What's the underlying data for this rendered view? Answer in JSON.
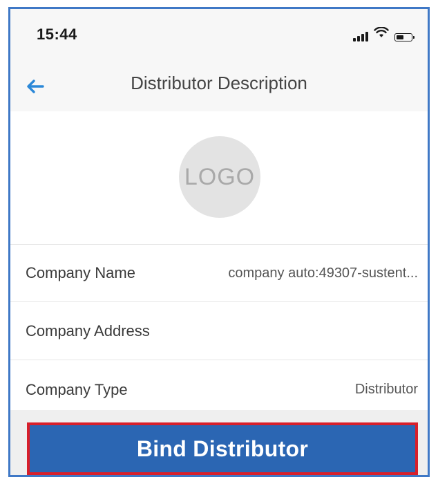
{
  "status_bar": {
    "time": "15:44",
    "icons": [
      "signal-icon",
      "wifi-icon",
      "battery-icon"
    ],
    "battery_level": 0.5
  },
  "nav_bar": {
    "back_icon": "arrow-left-icon",
    "title": "Distributor Description"
  },
  "logo": {
    "text": "LOGO"
  },
  "details": {
    "company_name": {
      "label": "Company Name",
      "value": "company auto:49307-sustent..."
    },
    "company_address": {
      "label": "Company Address",
      "value": ""
    },
    "company_type": {
      "label": "Company Type",
      "value": "Distributor"
    }
  },
  "actions": {
    "bind_label": "Bind Distributor"
  },
  "colors": {
    "frame_border": "#3f78c6",
    "accent_blue": "#2b88d8",
    "button_blue": "#2b66b3",
    "highlight_red": "#d81f2a"
  }
}
